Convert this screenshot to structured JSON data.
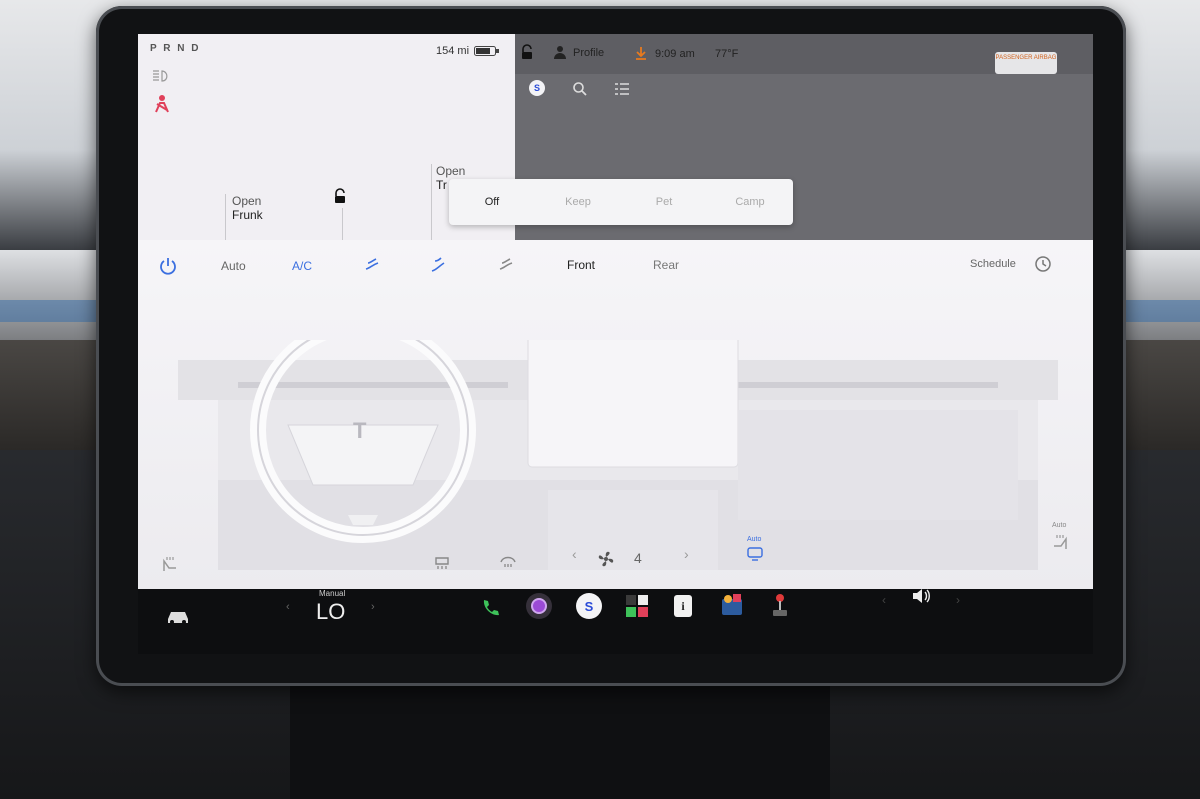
{
  "status": {
    "gear": "P R N D",
    "range": "154 mi",
    "profile": "Profile",
    "time": "9:09 am",
    "temp": "77°F",
    "airbag": "PASSENGER AIRBAG"
  },
  "car_status": {
    "frunk_label_1": "Open",
    "frunk_label_2": "Frunk",
    "trunk_label_1": "Open",
    "trunk_label_2": "Tr"
  },
  "popup": {
    "items": [
      "Off",
      "Keep",
      "Pet",
      "Camp"
    ],
    "selected": "Off"
  },
  "climate_bar": {
    "auto": "Auto",
    "ac": "A/C",
    "front": "Front",
    "rear": "Rear",
    "schedule": "Schedule"
  },
  "climate_bottom": {
    "fan_level": "4",
    "auto_left": "Auto",
    "auto_right": "Auto"
  },
  "taskbar": {
    "temp_mode": "Manual",
    "temp_value": "LO"
  },
  "colors": {
    "accent_blue": "#3b6fe0",
    "alert_red": "#e0405a",
    "download_orange": "#e87a1e",
    "phone_green": "#3ec25a"
  }
}
